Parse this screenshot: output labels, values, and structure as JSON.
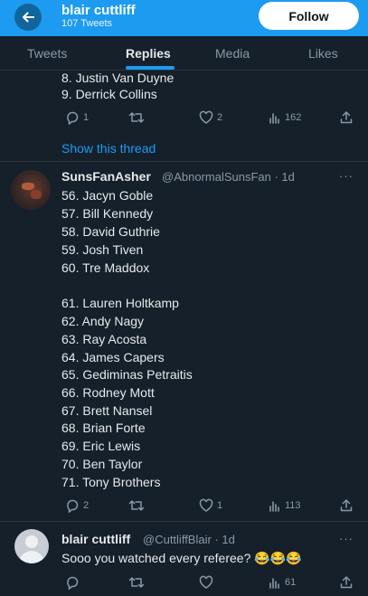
{
  "header": {
    "name": "blair cuttliff",
    "tweet_count": "107 Tweets",
    "follow_label": "Follow",
    "accent": "#1d9bf0"
  },
  "tabs": [
    {
      "label": "Tweets",
      "active": false
    },
    {
      "label": "Replies",
      "active": true
    },
    {
      "label": "Media",
      "active": false
    },
    {
      "label": "Likes",
      "active": false
    }
  ],
  "thread_top": {
    "lines": [
      "8. Justin Van Duyne",
      "9. Derrick Collins"
    ],
    "actions": {
      "replies": "1",
      "retweets": "",
      "likes": "2",
      "views": "162"
    },
    "show_thread": "Show this thread"
  },
  "tweet_asher": {
    "name": "SunsFanAsher",
    "handle_time": "@AbnormalSunsFan · 1d",
    "more": "···",
    "lines_a": [
      "56. Jacyn Goble",
      "57. Bill Kennedy",
      "58. David Guthrie",
      "59. Josh Tiven",
      "60. Tre Maddox"
    ],
    "lines_b": [
      "61. Lauren Holtkamp",
      "62. Andy Nagy",
      "63. Ray Acosta",
      "64. James Capers",
      "65. Gediminas Petraitis",
      "66. Rodney Mott",
      "67. Brett Nansel",
      "68. Brian Forte",
      "69. Eric Lewis",
      "70. Ben Taylor",
      "71. Tony Brothers"
    ],
    "actions": {
      "replies": "2",
      "retweets": "",
      "likes": "1",
      "views": "113"
    }
  },
  "tweet_blair": {
    "name": "blair cuttliff",
    "handle_time": "@CuttliffBlair · 1d",
    "more": "···",
    "text": "Sooo you watched every referee?",
    "emoji": "😂😂😂",
    "actions": {
      "replies": "",
      "retweets": "",
      "likes": "",
      "views": "61"
    }
  },
  "icons": [
    "back-arrow-icon",
    "reply-icon",
    "retweet-icon",
    "like-icon",
    "views-icon",
    "share-icon",
    "more-icon"
  ]
}
